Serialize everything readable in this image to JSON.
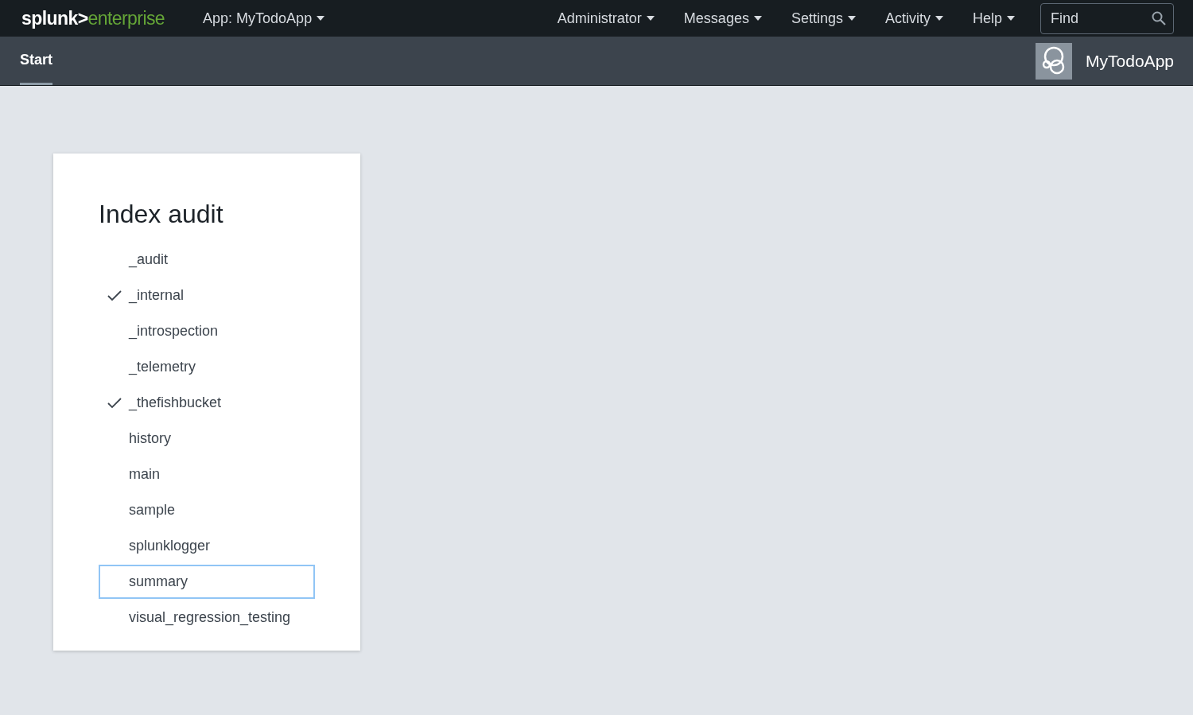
{
  "top_bar": {
    "logo": {
      "brand": "splunk>",
      "product": "enterprise"
    },
    "app_menu": "App: MyTodoApp",
    "menus": [
      "Administrator",
      "Messages",
      "Settings",
      "Activity",
      "Help"
    ],
    "search": {
      "placeholder": "Find"
    }
  },
  "app_bar": {
    "tabs": [
      {
        "label": "Start",
        "selected": true
      }
    ],
    "app_name": "MyTodoApp"
  },
  "card": {
    "title": "Index audit",
    "items": [
      {
        "label": "_audit",
        "checked": false,
        "focused": false
      },
      {
        "label": "_internal",
        "checked": true,
        "focused": false
      },
      {
        "label": "_introspection",
        "checked": false,
        "focused": false
      },
      {
        "label": "_telemetry",
        "checked": false,
        "focused": false
      },
      {
        "label": "_thefishbucket",
        "checked": true,
        "focused": false
      },
      {
        "label": "history",
        "checked": false,
        "focused": false
      },
      {
        "label": "main",
        "checked": false,
        "focused": false
      },
      {
        "label": "sample",
        "checked": false,
        "focused": false
      },
      {
        "label": "splunklogger",
        "checked": false,
        "focused": false
      },
      {
        "label": "summary",
        "checked": false,
        "focused": true
      },
      {
        "label": "visual_regression_testing",
        "checked": false,
        "focused": false
      }
    ]
  }
}
